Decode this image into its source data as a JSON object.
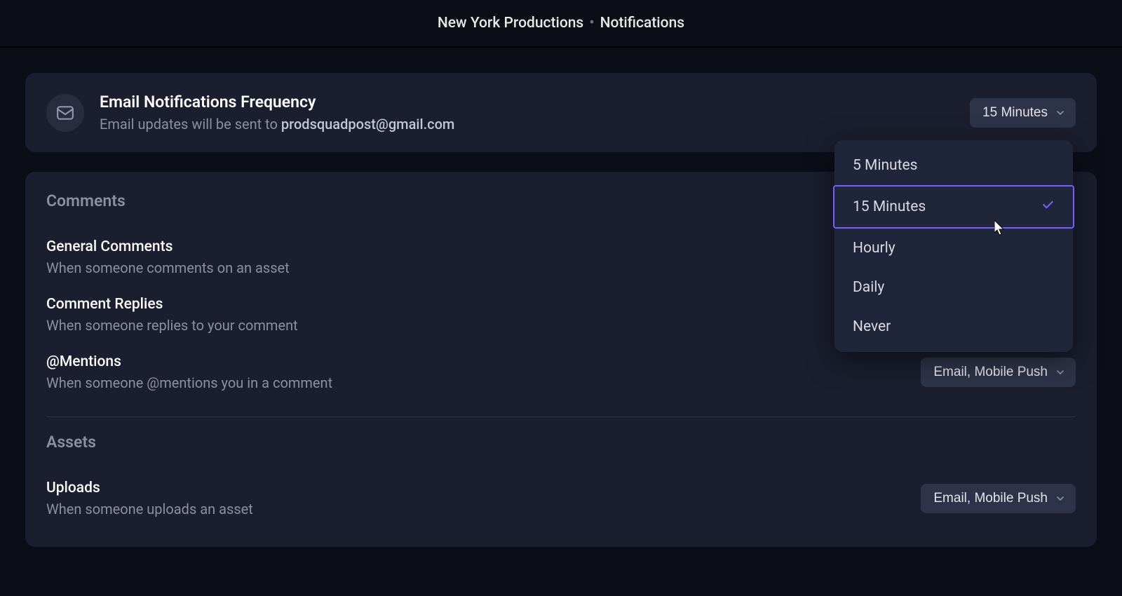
{
  "header": {
    "org": "New York Productions",
    "page": "Notifications"
  },
  "emailFrequency": {
    "title": "Email Notifications Frequency",
    "description_prefix": "Email updates will be sent to ",
    "email": "prodsquadpost@gmail.com",
    "selected": "15 Minutes",
    "options": [
      "5 Minutes",
      "15 Minutes",
      "Hourly",
      "Daily",
      "Never"
    ]
  },
  "sections": [
    {
      "title": "Comments",
      "rows": [
        {
          "title": "General Comments",
          "desc": "When someone comments on an asset",
          "value": null
        },
        {
          "title": "Comment Replies",
          "desc": "When someone replies to your comment",
          "value": null
        },
        {
          "title": "@Mentions",
          "desc": "When someone @mentions you in a comment",
          "value": "Email, Mobile Push"
        }
      ]
    },
    {
      "title": "Assets",
      "rows": [
        {
          "title": "Uploads",
          "desc": "When someone uploads an asset",
          "value": "Email, Mobile Push"
        }
      ]
    }
  ]
}
